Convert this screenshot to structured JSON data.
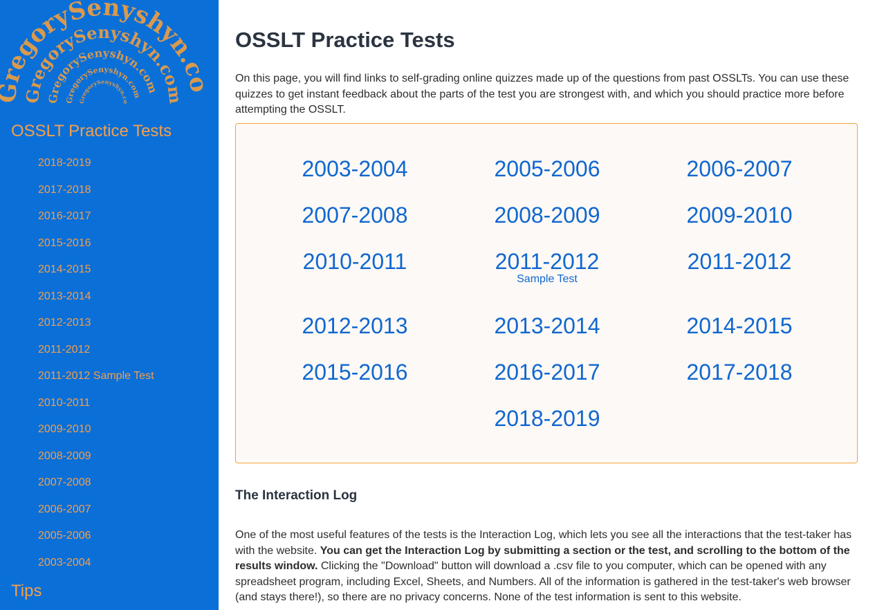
{
  "sidebar": {
    "logo_text": "GregorySenyshyn.com",
    "section_title": "OSSLT Practice Tests",
    "items": [
      {
        "label": "2018-2019"
      },
      {
        "label": "2017-2018"
      },
      {
        "label": "2016-2017"
      },
      {
        "label": "2015-2016"
      },
      {
        "label": "2014-2015"
      },
      {
        "label": "2013-2014"
      },
      {
        "label": "2012-2013"
      },
      {
        "label": "2011-2012"
      },
      {
        "label": "2011-2012 Sample Test"
      },
      {
        "label": "2010-2011"
      },
      {
        "label": "2009-2010"
      },
      {
        "label": "2008-2009"
      },
      {
        "label": "2007-2008"
      },
      {
        "label": "2006-2007"
      },
      {
        "label": "2005-2006"
      },
      {
        "label": "2003-2004"
      }
    ],
    "tips_label": "Tips"
  },
  "main": {
    "title": "OSSLT Practice Tests",
    "intro": "On this page, you will find links to self-grading online quizzes made up of the questions from past OSSLTs. You can use these quizzes to get instant feedback about the parts of the test you are strongest with, and which you should practice more before attempting the OSSLT.",
    "tests": [
      {
        "label": "2003-2004"
      },
      {
        "label": "2005-2006"
      },
      {
        "label": "2006-2007"
      },
      {
        "label": "2007-2008"
      },
      {
        "label": "2008-2009"
      },
      {
        "label": "2009-2010"
      },
      {
        "label": "2010-2011"
      },
      {
        "label": "2011-2012",
        "sub": "Sample Test"
      },
      {
        "label": "2011-2012"
      },
      {
        "label": "2012-2013"
      },
      {
        "label": "2013-2014"
      },
      {
        "label": "2014-2015"
      },
      {
        "label": "2015-2016"
      },
      {
        "label": "2016-2017"
      },
      {
        "label": "2017-2018"
      },
      {
        "label": "2018-2019"
      }
    ],
    "log_heading": "The Interaction Log",
    "log_text_1": "One of the most useful features of the tests is the Interaction Log, which lets you see all the interactions that the test-taker has with the website. ",
    "log_text_bold": "You can get the Interaction Log by submitting a section or the test, and scrolling to the bottom of the results window.",
    "log_text_2": " Clicking the \"Download\" button will download a .csv file to you computer, which can be opened with any spreadsheet program, including Excel, Sheets, and Numbers. All of the information is gathered in the test-taker's web browser (and stays there!), so there are no privacy concerns. None of the test information is sent to this website."
  },
  "colors": {
    "sidebar_bg": "#0b6fd8",
    "accent": "#f2a04a",
    "link": "#1067d0",
    "box_border": "#f0a43e",
    "box_bg": "#fdf9f6"
  }
}
